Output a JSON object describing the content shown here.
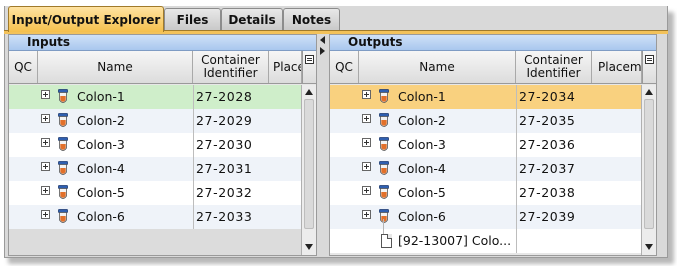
{
  "tabs": [
    {
      "label": "Input/Output Explorer",
      "active": true
    },
    {
      "label": "Files",
      "active": false
    },
    {
      "label": "Details",
      "active": false
    },
    {
      "label": "Notes",
      "active": false
    }
  ],
  "inputs": {
    "title": "Inputs",
    "columns": {
      "qc": "QC",
      "name": "Name",
      "container": "Container Identifier",
      "placement": "Placem"
    },
    "rows": [
      {
        "name": "Colon-1",
        "container": "27-2028",
        "selected": true
      },
      {
        "name": "Colon-2",
        "container": "27-2029"
      },
      {
        "name": "Colon-3",
        "container": "27-2030"
      },
      {
        "name": "Colon-4",
        "container": "27-2031"
      },
      {
        "name": "Colon-5",
        "container": "27-2032"
      },
      {
        "name": "Colon-6",
        "container": "27-2033"
      }
    ]
  },
  "outputs": {
    "title": "Outputs",
    "columns": {
      "qc": "QC",
      "name": "Name",
      "container": "Container Identifier",
      "placement": "Placem"
    },
    "rows": [
      {
        "name": "Colon-1",
        "container": "27-2034",
        "selected": true
      },
      {
        "name": "Colon-2",
        "container": "27-2035"
      },
      {
        "name": "Colon-3",
        "container": "27-2036"
      },
      {
        "name": "Colon-4",
        "container": "27-2037"
      },
      {
        "name": "Colon-5",
        "container": "27-2038"
      },
      {
        "name": "Colon-6",
        "container": "27-2039"
      }
    ],
    "file_row": {
      "name": "[92-13007] Colo...",
      "container": ""
    }
  },
  "colors": {
    "active_tab": "#f5c04d",
    "pane_title": "#a9c7ee",
    "selected_input_row": "#cfeeca",
    "selected_output_row": "#f9d17f",
    "alt_row": "#eff3f9"
  },
  "icons": [
    "tube-icon",
    "file-icon",
    "expand-icon",
    "column-chooser-icon",
    "collapse-left-icon",
    "collapse-right-icon"
  ]
}
